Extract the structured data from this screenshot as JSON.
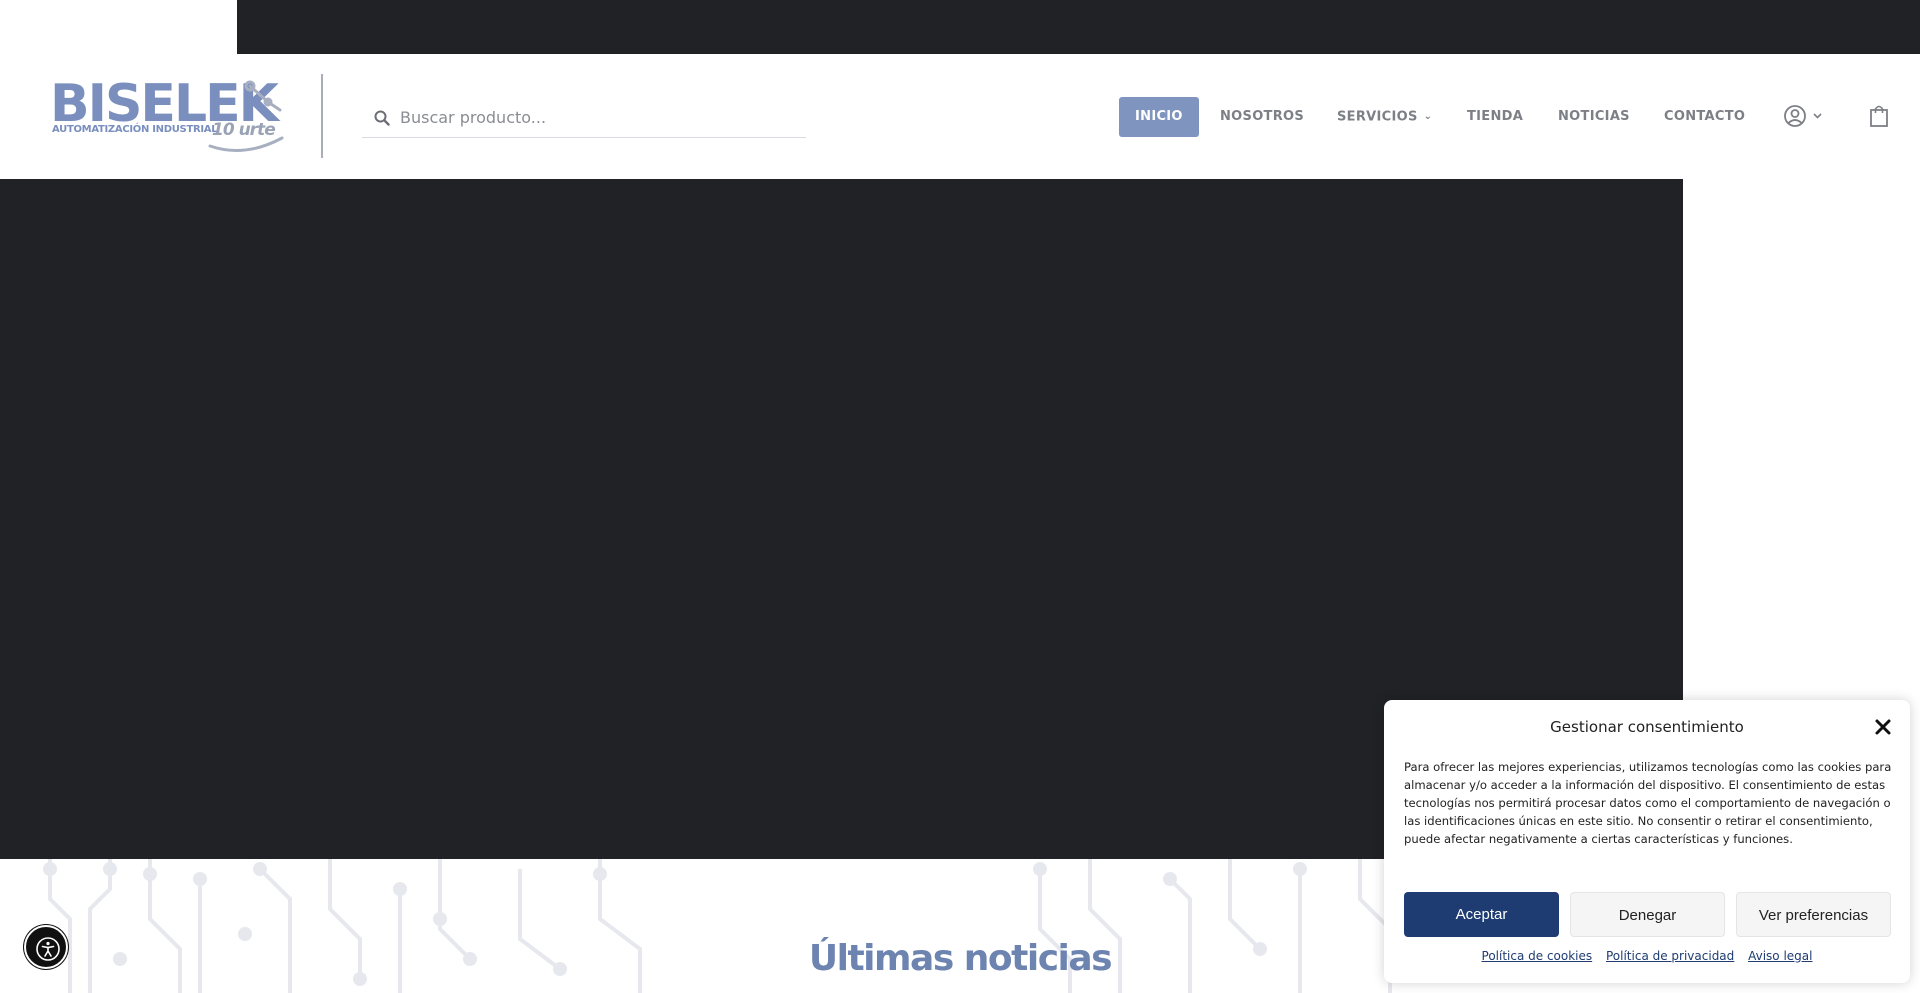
{
  "header": {
    "logo": {
      "brand": "BISELEK",
      "tagline": "AUTOMATIZACIÓN INDUSTRIAL",
      "anniversary": "10 urte"
    },
    "search": {
      "placeholder": "Buscar producto...",
      "icon": "search-icon"
    },
    "nav": {
      "items": [
        {
          "label": "INICIO",
          "active": true
        },
        {
          "label": "NOSOTROS"
        },
        {
          "label": "SERVICIOS",
          "has_dropdown": true
        },
        {
          "label": "TIENDA"
        },
        {
          "label": "NOTICIAS"
        },
        {
          "label": "CONTACTO"
        }
      ],
      "user_icon": "user-circle-icon",
      "cart_icon": "shopping-bag-icon"
    },
    "colors": {
      "accent": "#7f95bf",
      "dark": "#212226"
    }
  },
  "main": {
    "news_title": "Últimas noticias"
  },
  "accessibility": {
    "icon": "accessibility-icon"
  },
  "consent": {
    "title": "Gestionar consentimiento",
    "text": "Para ofrecer las mejores experiencias, utilizamos tecnologías como las cookies para almacenar y/o acceder a la información del dispositivo. El consentimiento de estas tecnologías nos permitirá procesar datos como el comportamiento de navegación o las identificaciones únicas en este sitio. No consentir o retirar el consentimiento, puede afectar negativamente a ciertas características y funciones.",
    "accept_label": "Aceptar",
    "deny_label": "Denegar",
    "prefs_label": "Ver preferencias",
    "links": [
      "Política de cookies",
      "Política de privacidad",
      "Aviso legal"
    ],
    "accept_color": "#1e3c72"
  }
}
